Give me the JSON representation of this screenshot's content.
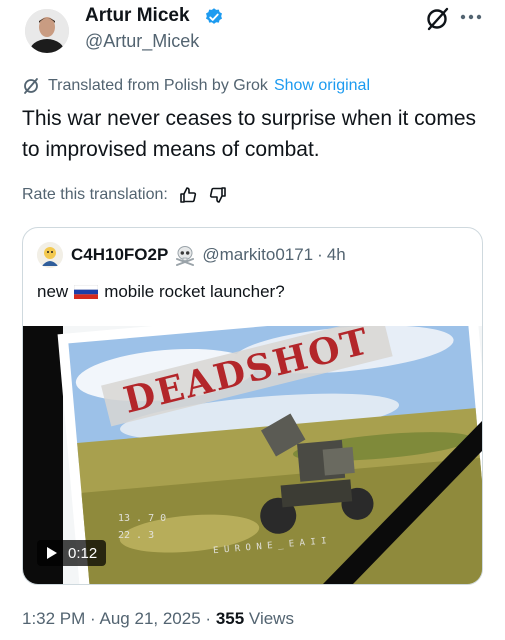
{
  "author": {
    "name": "Artur Micek",
    "handle": "@Artur_Micek",
    "avatar_icon": "profile-photo",
    "verified_icon": "verified-badge-icon"
  },
  "actions": {
    "grok_icon": "grok-icon",
    "more_icon": "more-icon"
  },
  "translation": {
    "note": "Translated from Polish by Grok",
    "show_original": "Show original"
  },
  "tweet": {
    "text": "This war never ceases to surprise when it comes to improvised means of combat."
  },
  "rating": {
    "label": "Rate this translation:",
    "thumbs_up_icon": "thumbs-up-icon",
    "thumbs_down_icon": "thumbs-down-icon"
  },
  "quote": {
    "name": "C4H10FO2P",
    "handle": "@markito0171",
    "separator": "·",
    "time": "4h",
    "text_before": "new",
    "text_after": "mobile rocket launcher?",
    "flag_icon": "russian-flag-icon",
    "skull_icon": "skull-crossbones-icon",
    "media": {
      "overlay_text": "DEADSHOT",
      "duration": "0:12",
      "play_icon": "play-icon"
    }
  },
  "footer": {
    "time": "1:32 PM",
    "separator": "·",
    "date": "Aug 21, 2025",
    "separator2": "·",
    "views_count": "355",
    "views_label": "Views"
  },
  "colors": {
    "accent": "#1d9bf0",
    "text": "#0f1419",
    "muted": "#536471",
    "border": "#cfd9de"
  }
}
